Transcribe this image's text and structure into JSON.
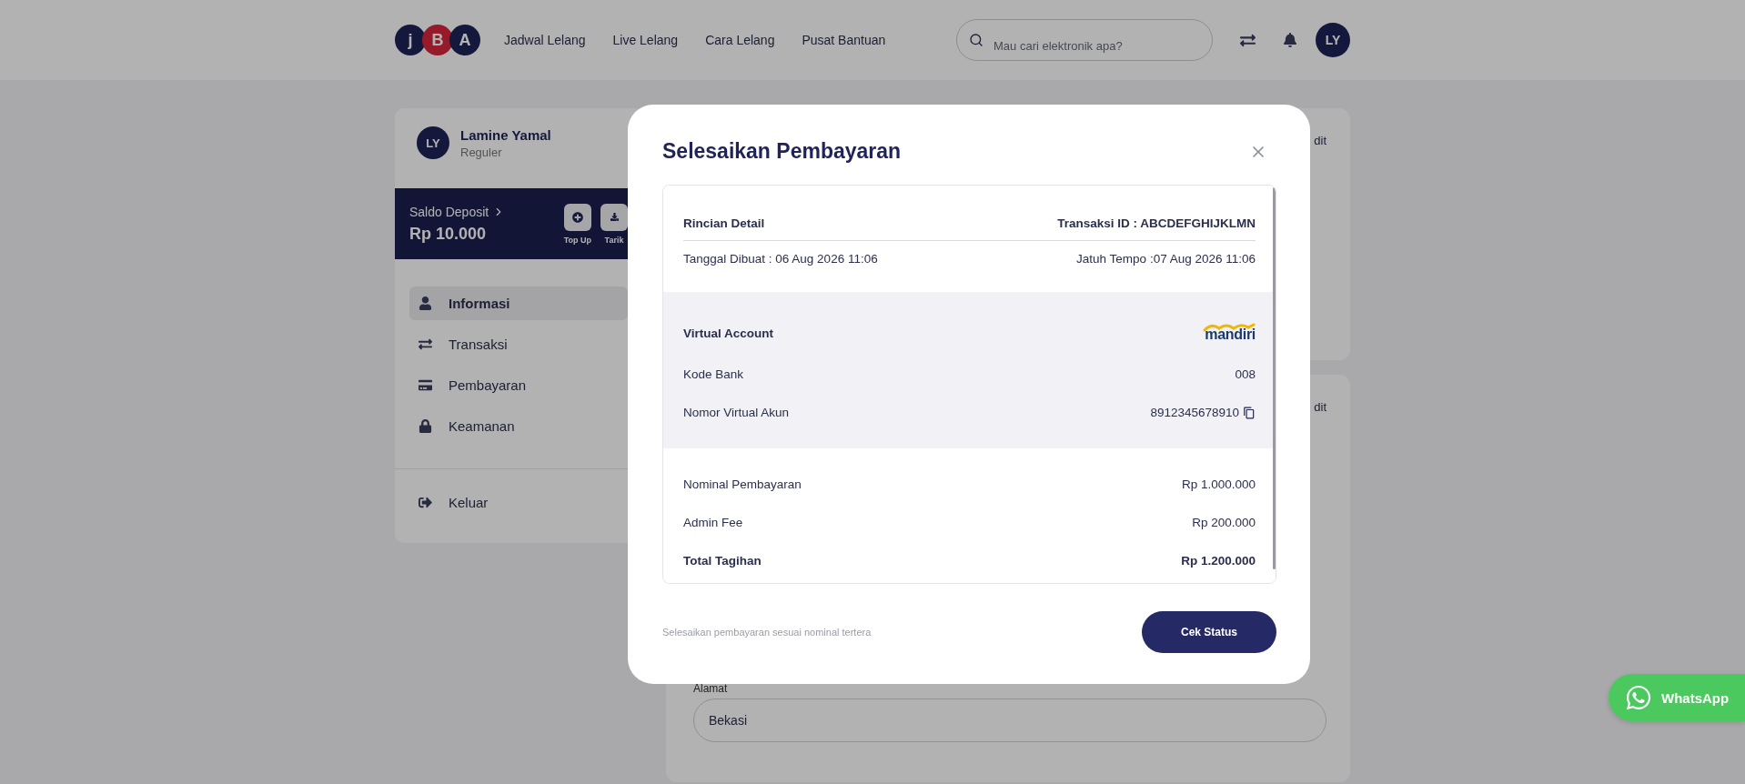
{
  "header": {
    "logo": [
      {
        "letter": "j",
        "accent": false
      },
      {
        "letter": "B",
        "accent": true
      },
      {
        "letter": "A",
        "accent": false
      }
    ],
    "nav": [
      "Jadwal Lelang",
      "Live Lelang",
      "Cara Lelang",
      "Pusat Bantuan"
    ],
    "search": {
      "placeholder": "Mau cari elektronik apa?"
    },
    "avatar": "LY"
  },
  "profile": {
    "avatar": "LY",
    "name": "Lamine Yamal",
    "tier": "Reguler"
  },
  "deposit": {
    "label": "Saldo Deposit",
    "amount": "Rp 10.000",
    "actions": [
      {
        "label": "Top Up",
        "kind": "topup"
      },
      {
        "label": "Tarik",
        "kind": "withdraw"
      }
    ]
  },
  "menu": [
    {
      "label": "Informasi",
      "kind": "user",
      "selected": true
    },
    {
      "label": "Transaksi",
      "kind": "transfer",
      "selected": false
    },
    {
      "label": "Pembayaran",
      "kind": "card",
      "selected": false
    },
    {
      "label": "Keamanan",
      "kind": "lock",
      "selected": false
    }
  ],
  "logout": {
    "label": "Keluar"
  },
  "background_cards": [
    {
      "link": "dit"
    },
    {
      "link": "dit",
      "address_label": "Alamat",
      "address_value": "Bekasi"
    }
  ],
  "modal": {
    "title": "Selesaikan Pembayaran",
    "detail": {
      "heading": "Rincian Detail",
      "transaction_id": "Transaksi ID : ABCDEFGHIJKLMN",
      "created": "Tanggal Dibuat : 06 Aug 2026 11:06",
      "due": "Jatuh Tempo :07 Aug 2026 11:06"
    },
    "virtual_account": {
      "label": "Virtual Account",
      "bank_logo": "mandiri",
      "rows": [
        {
          "label": "Kode Bank",
          "value": "008",
          "copyable": false
        },
        {
          "label": "Nomor Virtual Akun",
          "value": "8912345678910",
          "copyable": true
        }
      ]
    },
    "amounts": [
      {
        "label": "Nominal Pembayaran",
        "value": "Rp 1.000.000",
        "total": false
      },
      {
        "label": "Admin Fee",
        "value": "Rp 200.000",
        "total": false
      },
      {
        "label": "Total Tagihan",
        "value": "Rp 1.200.000",
        "total": true
      }
    ],
    "note": "Selesaikan pembayaran sesuai nominal tertera",
    "button": "Cek Status"
  },
  "whatsapp": {
    "label": "WhatsApp"
  }
}
